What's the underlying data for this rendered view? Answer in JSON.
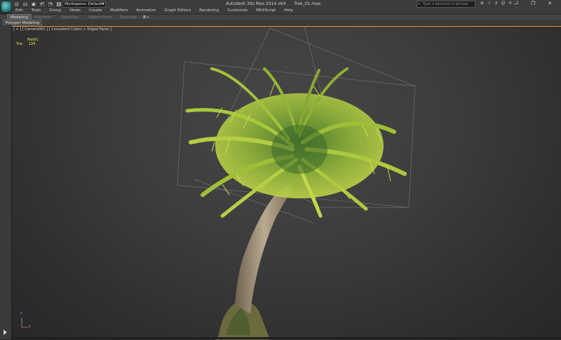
{
  "titlebar": {
    "workspace_label": "Workspace: Default",
    "app_title": "Autodesk 3ds Max  2014 x64",
    "file_name": "Tree_01.max",
    "search_placeholder": "Type a keyword or phrase",
    "quick_access_icons": [
      "new-file-icon",
      "open-file-icon",
      "save-icon",
      "undo-icon",
      "redo-icon",
      "project-icon",
      "dropdown-icon"
    ],
    "toolbar_icons": [
      "binoculars-icon",
      "star-icon",
      "key-icon",
      "user-icon",
      "exchange-icon",
      "help-icon"
    ],
    "window_controls": {
      "minimize": "—",
      "restore": "❐",
      "close": "✕"
    }
  },
  "menu": {
    "items": [
      "Edit",
      "Tools",
      "Group",
      "Views",
      "Create",
      "Modifiers",
      "Animation",
      "Graph Editors",
      "Rendering",
      "Customize",
      "MAXScript",
      "Help"
    ]
  },
  "ribbon": {
    "tabs": [
      "Modeling",
      "Freeform",
      "Selection",
      "Object Paint",
      "Populate"
    ],
    "active_tab": "Modeling",
    "panel_label": "Polygon Modeling"
  },
  "viewport": {
    "label": "[ + ] [ Camera001 ] [ Consistent Colors + Edged Faces ]",
    "stats_header": "Mat01",
    "stats_label": "Tris:",
    "stats_value": "139",
    "axis_x": "x",
    "axis_z": "z",
    "accent_color": "#e1a83a",
    "foliage_color": "#a8c43a",
    "trunk_color": "#a09078"
  }
}
